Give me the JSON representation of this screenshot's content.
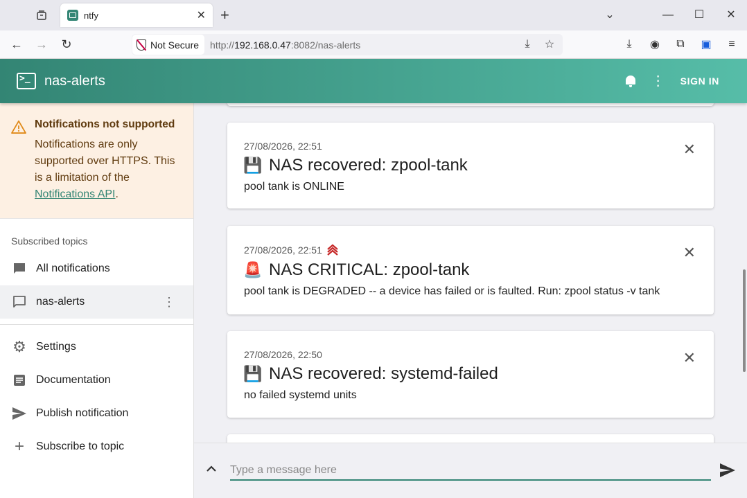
{
  "browser": {
    "tab_title": "ntfy",
    "not_secure_label": "Not Secure",
    "url_prefix": "http://",
    "url_host": "192.168.0.47",
    "url_rest": ":8082/nas-alerts"
  },
  "appbar": {
    "title": "nas-alerts",
    "signin_label": "SIGN IN"
  },
  "sidebar": {
    "alert": {
      "title": "Notifications not supported",
      "body": "Notifications are only supported over HTTPS. This is a limitation of the ",
      "link": "Notifications API",
      "suffix": "."
    },
    "section_label": "Subscribed topics",
    "topics": [
      {
        "label": "All notifications"
      },
      {
        "label": "nas-alerts"
      }
    ],
    "items": [
      {
        "label": "Settings"
      },
      {
        "label": "Documentation"
      },
      {
        "label": "Publish notification"
      },
      {
        "label": "Subscribe to topic"
      }
    ]
  },
  "notifications": [
    {
      "time": "27/08/2026, 22:51",
      "emoji": "💾",
      "title": "NAS recovered: zpool-tank",
      "message": "pool tank is ONLINE",
      "priority": "default"
    },
    {
      "time": "27/08/2026, 22:51",
      "emoji": "🚨",
      "title": "NAS CRITICAL: zpool-tank",
      "message": "pool tank is DEGRADED -- a device has failed or is faulted. Run: zpool status -v tank",
      "priority": "urgent"
    },
    {
      "time": "27/08/2026, 22:50",
      "emoji": "💾",
      "title": "NAS recovered: systemd-failed",
      "message": "no failed systemd units",
      "priority": "default"
    }
  ],
  "composer": {
    "placeholder": "Type a message here"
  },
  "colors": {
    "accent": "#338574",
    "urgent": "#c62828"
  }
}
